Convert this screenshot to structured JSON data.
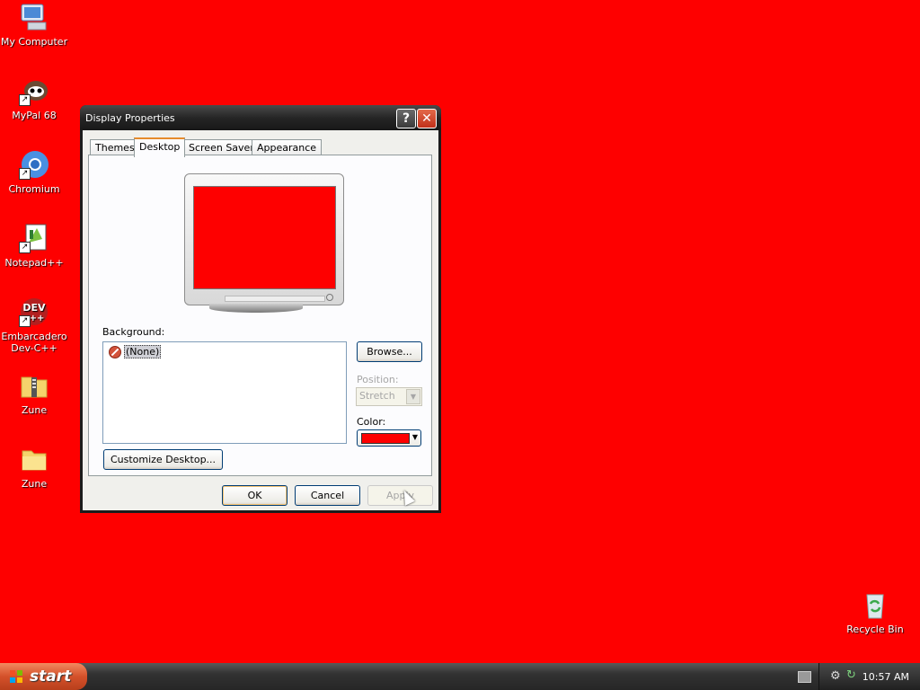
{
  "desktop": {
    "background_color": "#fe0000",
    "icons": [
      {
        "label": "My Computer",
        "icon": "computer-icon"
      },
      {
        "label": "MyPal 68",
        "icon": "mypal-icon"
      },
      {
        "label": "Chromium",
        "icon": "chromium-icon"
      },
      {
        "label": "Notepad++",
        "icon": "notepadpp-icon"
      },
      {
        "label": "Embarcadero Dev-C++",
        "icon": "devcpp-icon"
      },
      {
        "label": "Zune",
        "icon": "zip-folder-icon"
      },
      {
        "label": "Zune",
        "icon": "folder-icon"
      },
      {
        "label": "Recycle Bin",
        "icon": "recycle-bin-icon"
      }
    ]
  },
  "dialog": {
    "title": "Display Properties",
    "help_glyph": "?",
    "close_glyph": "✕",
    "tabs": [
      {
        "label": "Themes"
      },
      {
        "label": "Desktop",
        "active": true
      },
      {
        "label": "Screen Saver"
      },
      {
        "label": "Appearance"
      }
    ],
    "preview_color": "#fe0000",
    "background_label": "Background:",
    "background_items": [
      {
        "label": "(None)",
        "selected": true
      }
    ],
    "browse_label": "Browse...",
    "position_label": "Position:",
    "position_value": "Stretch",
    "color_label": "Color:",
    "color_value": "#fe0000",
    "customize_label": "Customize Desktop...",
    "ok_label": "OK",
    "cancel_label": "Cancel",
    "apply_label": "Apply"
  },
  "taskbar": {
    "start_label": "start",
    "clock": "10:57 AM"
  }
}
